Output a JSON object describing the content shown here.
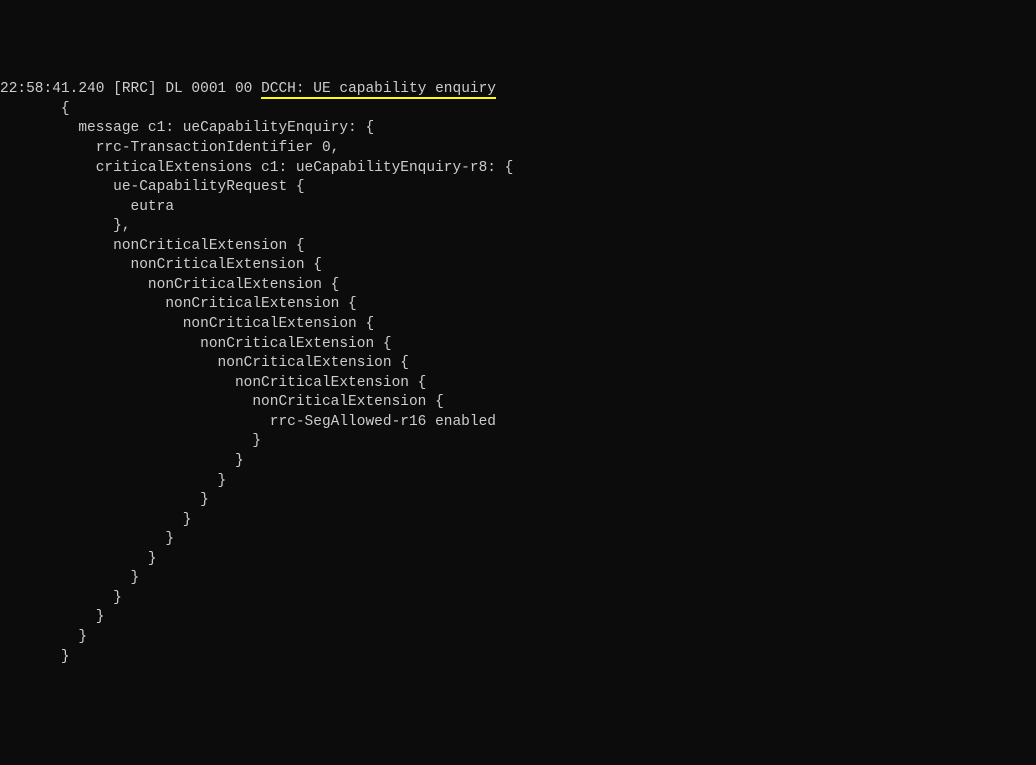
{
  "log": {
    "timestamp": "22:58:41.240",
    "header_pre": " [RRC] DL 0001 00 ",
    "header_underlined": "DCCH: UE capability enquiry",
    "lines": [
      "       {",
      "         message c1: ueCapabilityEnquiry: {",
      "           rrc-TransactionIdentifier 0,",
      "           criticalExtensions c1: ueCapabilityEnquiry-r8: {",
      "             ue-CapabilityRequest {",
      "               eutra",
      "             },",
      "             nonCriticalExtension {",
      "               nonCriticalExtension {",
      "                 nonCriticalExtension {",
      "                   nonCriticalExtension {",
      "                     nonCriticalExtension {",
      "                       nonCriticalExtension {",
      "                         nonCriticalExtension {",
      "                           nonCriticalExtension {",
      "                             nonCriticalExtension {",
      "                               rrc-SegAllowed-r16 enabled",
      "                             }",
      "                           }",
      "                         }",
      "                       }",
      "                     }",
      "                   }",
      "                 }",
      "               }",
      "             }",
      "           }",
      "         }",
      "       }"
    ]
  }
}
